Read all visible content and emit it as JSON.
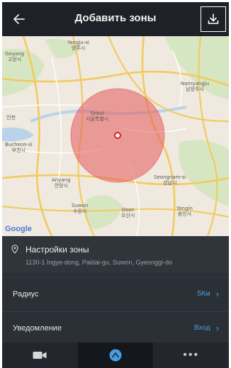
{
  "header": {
    "title": "Добавить зоны",
    "back_icon": "arrow-left-icon",
    "download_icon": "download-icon"
  },
  "map": {
    "labels": {
      "goyang": "Goyang\n고양시",
      "yangju": "Yangju-si\n양주시",
      "namyangju": "Namyangju\n남양주시",
      "seoul": "Seoul\n서울특별시",
      "bucheon": "Bucheon-si\n부천시",
      "seongnam": "Seongnam-si\n성남시",
      "anyang": "Anyang\n안양시",
      "suwon": "Suwon\n수원시",
      "osan": "Osan\n오산시",
      "yongin": "Yongin\n용인시",
      "incheon": "인천"
    },
    "google_label": "Google",
    "zone_color": "#e45a5a"
  },
  "zone": {
    "title": "Настройки зоны",
    "address": "1130-1 Ingye-dong, Paldal-gu, Suwon, Gyeonggi-do"
  },
  "rows": {
    "radius": {
      "label": "Радиус",
      "value": "5Км"
    },
    "notification": {
      "label": "Уведомление",
      "value": "Вход"
    }
  },
  "nav": {
    "items": [
      "video-camera-icon",
      "location-icon",
      "more-icon"
    ],
    "more_label": "•••"
  },
  "colors": {
    "accent": "#4a9de0",
    "header_bg": "#1e2228",
    "panel_bg": "#2b2f36"
  }
}
